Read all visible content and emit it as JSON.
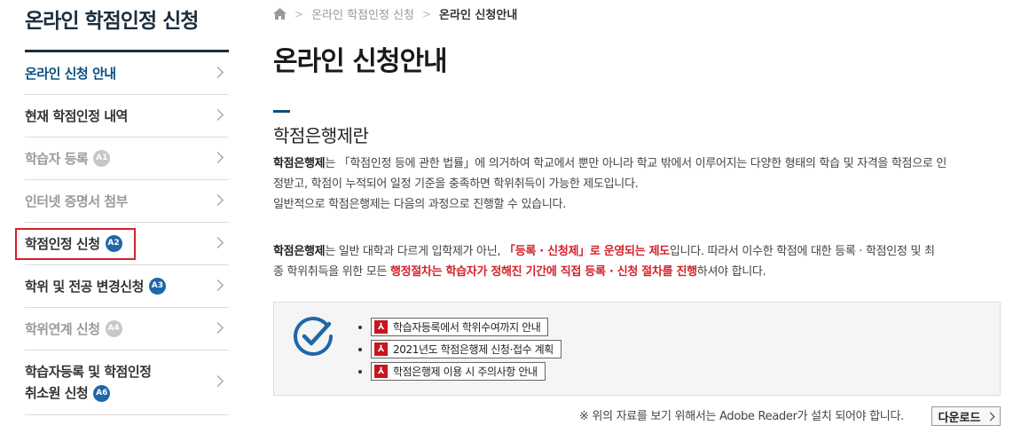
{
  "sidebar": {
    "title": "온라인 학점인정 신청",
    "items": [
      {
        "label": "온라인 신청 안내",
        "badge": ""
      },
      {
        "label": "현재 학점인정 내역",
        "badge": ""
      },
      {
        "label": "학습자 등록",
        "badge": "A1"
      },
      {
        "label": "인터넷 증명서 첨부",
        "badge": ""
      },
      {
        "label": "학점인정 신청",
        "badge": "A2"
      },
      {
        "label": "학위 및 전공 변경신청",
        "badge": "A3"
      },
      {
        "label": "학위연계 신청",
        "badge": "A4"
      },
      {
        "label_line1": "학습자등록 및 학점인정",
        "label_line2": "취소원 신청",
        "badge": "A6"
      }
    ]
  },
  "breadcrumb": {
    "level1": "온라인 학점인정 신청",
    "current": "온라인 신청안내"
  },
  "page_title": "온라인 신청안내",
  "section_title": "학점은행제란",
  "para1": {
    "bold": "학점은행제",
    "text1": "는 「학점인정 등에 관한 법률」에 의거하여 학교에서 뿐만 아니라 학교 밖에서 이루어지는 다양한 형태의 학습 및 자격을 학점으로 인",
    "text2": "정받고, 학점이 누적되어 일정 기준을 충족하면 학위취득이 가능한 제도입니다.",
    "text3": "일반적으로 학점은행제는 다음의 과정으로 진행할 수 있습니다."
  },
  "para2": {
    "bold": "학점은행제",
    "text_a": "는 일반 대학과 다르게 입학제가 아닌, ",
    "red1": "「등록 · 신청제」로 운영되는 제도",
    "text_b": "입니다. 따라서 이수한 학점에 대한 등록 · 학점인정 및 최",
    "text_c": "종 학위취득을 위한 모든 ",
    "red2": "행정절차는 학습자가 정해진 기간에 직접 등록 · 신청 절차를 진행",
    "text_d": "하셔야 합니다."
  },
  "downloads": [
    {
      "label": "학습자등록에서 학위수여까지 안내"
    },
    {
      "label": "2021년도 학점은행제 신청·접수 계획"
    },
    {
      "label": "학점은행제 이용 시 주의사항 안내"
    }
  ],
  "note": "※ 위의 자료를 보기 위해서는 Adobe Reader가 설치 되어야 합니다.",
  "download_button": "다운로드",
  "colors": {
    "navy": "#1c2e3f",
    "accent": "#0a4f83",
    "red": "#d2232a",
    "badge": "#1f67a8"
  }
}
